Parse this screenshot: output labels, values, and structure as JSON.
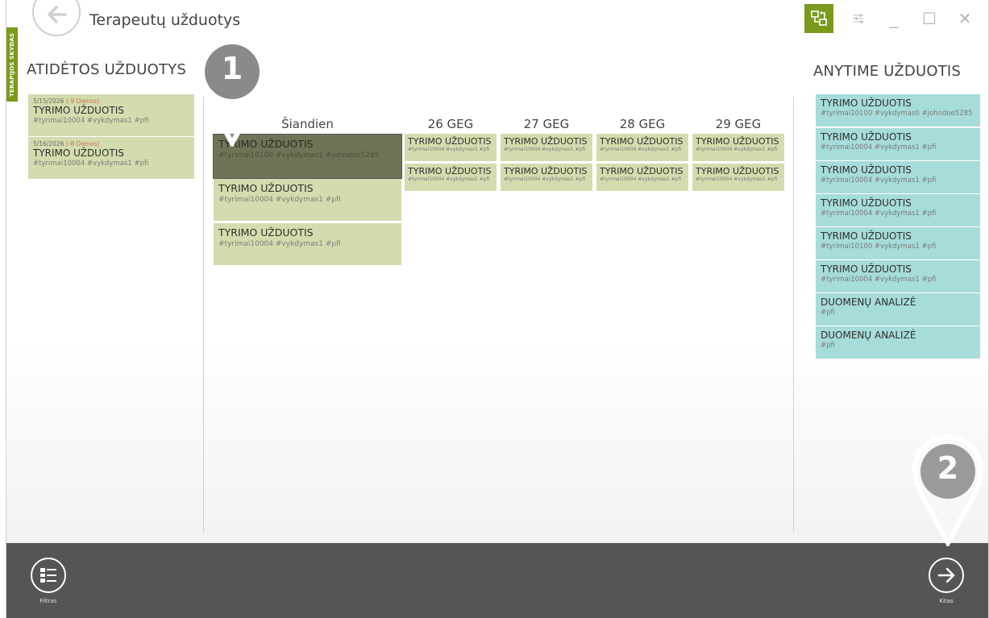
{
  "app": {
    "title": "Terapeutų užduotys",
    "side_tab": "TERAPIJOS SKYDAS"
  },
  "window_controls": {
    "minimize": "_",
    "maximize": "☐",
    "close": "✕"
  },
  "colors": {
    "accent": "#7a9a1c",
    "task_card": "#d3dcae",
    "task_selected": "#6f7457",
    "anytime_card": "#a6dcd9",
    "bottom_bar": "#555555",
    "overdue": "#d07050"
  },
  "overdue": {
    "heading": "ATIDĖTOS UŽDUOTYS",
    "items": [
      {
        "date": "5/15/2026",
        "delay": "(-9 Dienos)",
        "title": "TYRIMO UŽDUOTIS",
        "tags": "#tyrimai10004 #vykdymas1 #pfi"
      },
      {
        "date": "5/16/2026",
        "delay": "(-8 Dienos)",
        "title": "TYRIMO UŽDUOTIS",
        "tags": "#tyrimai10004 #vykdymas1 #pfi"
      }
    ]
  },
  "schedule": {
    "columns": [
      {
        "header": "Šiandien",
        "tasks": [
          {
            "title": "TYRIMO UŽDUOTIS",
            "tags": "#tyrimai10100 #vykdymas1 #johndoe5285",
            "selected": true
          },
          {
            "title": "TYRIMO UŽDUOTIS",
            "tags": "#tyrimai10004 #vykdymas1 #pfi"
          },
          {
            "title": "TYRIMO UŽDUOTIS",
            "tags": "#tyrimai10004 #vykdymas1 #pfi"
          }
        ]
      },
      {
        "header": "26 GEG",
        "tasks": [
          {
            "title": "TYRIMO UŽDUOTIS",
            "tags": "#tyrimai10004 #vykdymas1 #pfi"
          },
          {
            "title": "TYRIMO UŽDUOTIS",
            "tags": "#tyrimai10004 #vykdymas1 #pfi"
          }
        ]
      },
      {
        "header": "27 GEG",
        "tasks": [
          {
            "title": "TYRIMO UŽDUOTIS",
            "tags": "#tyrimai10004 #vykdymas1 #pfi"
          },
          {
            "title": "TYRIMO UŽDUOTIS",
            "tags": "#tyrimai10004 #vykdymas1 #pfi"
          }
        ]
      },
      {
        "header": "28 GEG",
        "tasks": [
          {
            "title": "TYRIMO UŽDUOTIS",
            "tags": "#tyrimai10004 #vykdymas1 #pfi"
          },
          {
            "title": "TYRIMO UŽDUOTIS",
            "tags": "#tyrimai10004 #vykdymas1 #pfi"
          }
        ]
      },
      {
        "header": "29 GEG",
        "tasks": [
          {
            "title": "TYRIMO UŽDUOTIS",
            "tags": "#tyrimai10004 #vykdymas1 #pfi"
          },
          {
            "title": "TYRIMO UŽDUOTIS",
            "tags": "#tyrimai10004 #vykdymas1 #pfi"
          }
        ]
      }
    ]
  },
  "anytime": {
    "heading": "ANYTIME UŽDUOTIS",
    "items": [
      {
        "title": "TYRIMO UŽDUOTIS",
        "tags": "#tyrimai10100 #vykdymas0 #johndoe5285"
      },
      {
        "title": "TYRIMO UŽDUOTIS",
        "tags": "#tyrimai10004 #vykdymas1 #pfi"
      },
      {
        "title": "TYRIMO UŽDUOTIS",
        "tags": "#tyrimai10004 #vykdymas1 #pfi"
      },
      {
        "title": "TYRIMO UŽDUOTIS",
        "tags": "#tyrimai10004 #vykdymas1 #pfi"
      },
      {
        "title": "TYRIMO UŽDUOTIS",
        "tags": "#tyrimai10100 #vykdymas1 #pfi"
      },
      {
        "title": "TYRIMO UŽDUOTIS",
        "tags": "#tyrimai10004 #vykdymas1 #pfi"
      },
      {
        "title": "DUOMENŲ ANALIZĖ",
        "tags": "#pfi"
      },
      {
        "title": "DUOMENŲ ANALIZĖ",
        "tags": "#pfi"
      }
    ]
  },
  "bottom_bar": {
    "filter_label": "Filtras",
    "next_label": "Kitas"
  },
  "callouts": [
    "1",
    "2"
  ]
}
